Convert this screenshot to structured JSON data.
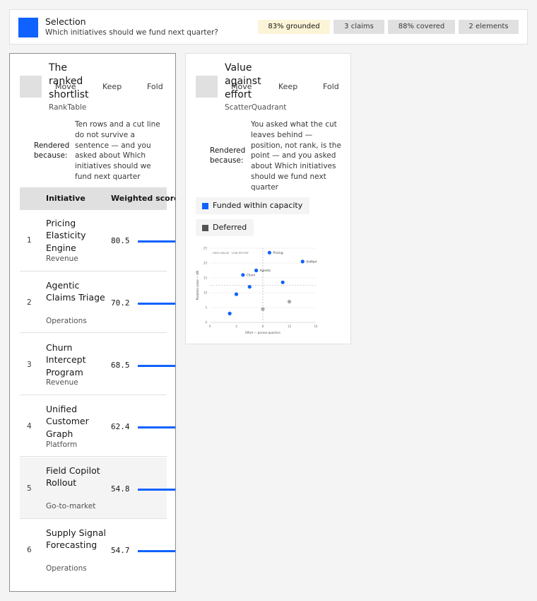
{
  "selection": {
    "title": "Selection",
    "question": "Which initiatives should we fund next quarter?",
    "badges": {
      "grounded": "83% grounded",
      "claims": "3 claims",
      "covered": "88% covered",
      "elements": "2 elements"
    }
  },
  "actions": {
    "move": "Move",
    "keep": "Keep",
    "fold": "Fold"
  },
  "rank_card": {
    "title": "The ranked shortlist",
    "component": "RankTable",
    "because_label": "Rendered because:",
    "reason": "Ten rows and a cut line do not survive a sentence — and you asked about Which initiatives should we fund next quarter",
    "columns": [
      "Initiative",
      "Weighted score"
    ],
    "rows": [
      {
        "rank": "1",
        "name": "Pricing Elasticity Engine",
        "category": "Revenue",
        "score": "80.5"
      },
      {
        "rank": "2",
        "name": "Agentic Claims Triage",
        "category": "Operations",
        "score": "70.2"
      },
      {
        "rank": "3",
        "name": "Churn Intercept Program",
        "category": "Revenue",
        "score": "68.5"
      },
      {
        "rank": "4",
        "name": "Unified Customer Graph",
        "category": "Platform",
        "score": "62.4"
      },
      {
        "rank": "5",
        "name": "Field Copilot Rollout",
        "category": "Go-to-market",
        "score": "54.8"
      },
      {
        "rank": "6",
        "name": "Supply Signal Forecasting",
        "category": "Operations",
        "score": "54.7"
      }
    ]
  },
  "scatter_card": {
    "title": "Value against effort",
    "component": "ScatterQuadrant",
    "because_label": "Rendered because:",
    "reason": "You asked what the cut leaves behind — position, not rank, is the point — and you asked about Which initiatives should we fund next quarter",
    "legend": [
      {
        "label": "Funded within capacity",
        "color": "#0f62fe"
      },
      {
        "label": "Deferred",
        "color": "#525252"
      }
    ]
  },
  "colors": {
    "accent": "#0f62fe",
    "deferred": "#a8a8a8",
    "grounded_bg": "#fcf4d6"
  },
  "chart_data": {
    "type": "scatter",
    "title": "",
    "annotation": "HIGH VALUE · LOW EFFORT",
    "xlabel": "Effort — person-quarters",
    "ylabel": "Modeled value — $M",
    "xlim": [
      0,
      16
    ],
    "ylim": [
      0,
      25
    ],
    "xticks": [
      0,
      4,
      8,
      12,
      16
    ],
    "yticks": [
      0,
      5,
      10,
      15,
      20,
      25
    ],
    "threshold_x": 8,
    "threshold_y": 12.5,
    "series": [
      {
        "name": "Funded within capacity",
        "color": "#0f62fe",
        "points": [
          {
            "x": 9,
            "y": 23.5,
            "label": "Pricing"
          },
          {
            "x": 14,
            "y": 20.5,
            "label": "Unified"
          },
          {
            "x": 7,
            "y": 17.5,
            "label": "Agentic"
          },
          {
            "x": 5,
            "y": 16,
            "label": "Churn"
          },
          {
            "x": 11,
            "y": 13.5,
            "label": ""
          },
          {
            "x": 6,
            "y": 12,
            "label": ""
          },
          {
            "x": 4,
            "y": 9.5,
            "label": ""
          },
          {
            "x": 3,
            "y": 3,
            "label": ""
          }
        ]
      },
      {
        "name": "Deferred",
        "color": "#a8a8a8",
        "points": [
          {
            "x": 12,
            "y": 7,
            "label": ""
          },
          {
            "x": 8,
            "y": 4.5,
            "label": ""
          }
        ]
      }
    ]
  }
}
